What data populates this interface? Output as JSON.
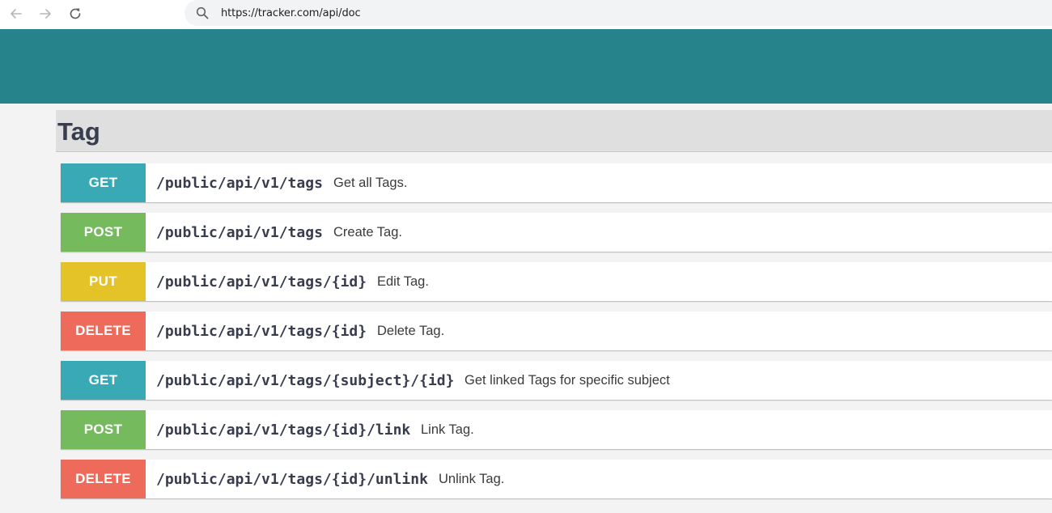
{
  "browser": {
    "url": "https://tracker.com/api/doc",
    "icons": [
      "back-arrow-icon",
      "forward-arrow-icon",
      "reload-icon",
      "search-icon"
    ]
  },
  "colors": {
    "header": "#27838b",
    "GET": "#3aa9b6",
    "POST": "#75bb5e",
    "PUT": "#e4c329",
    "DELETE": "#ee6b5b"
  },
  "section": {
    "title": "Tag"
  },
  "endpoints": [
    {
      "method": "GET",
      "path": "/public/api/v1/tags",
      "description": "Get all Tags."
    },
    {
      "method": "POST",
      "path": "/public/api/v1/tags",
      "description": "Create Tag."
    },
    {
      "method": "PUT",
      "path": "/public/api/v1/tags/{id}",
      "description": "Edit Tag."
    },
    {
      "method": "DELETE",
      "path": "/public/api/v1/tags/{id}",
      "description": "Delete Tag."
    },
    {
      "method": "GET",
      "path": "/public/api/v1/tags/{subject}/{id}",
      "description": "Get linked Tags for specific subject"
    },
    {
      "method": "POST",
      "path": "/public/api/v1/tags/{id}/link",
      "description": "Link Tag."
    },
    {
      "method": "DELETE",
      "path": "/public/api/v1/tags/{id}/unlink",
      "description": "Unlink Tag."
    }
  ]
}
